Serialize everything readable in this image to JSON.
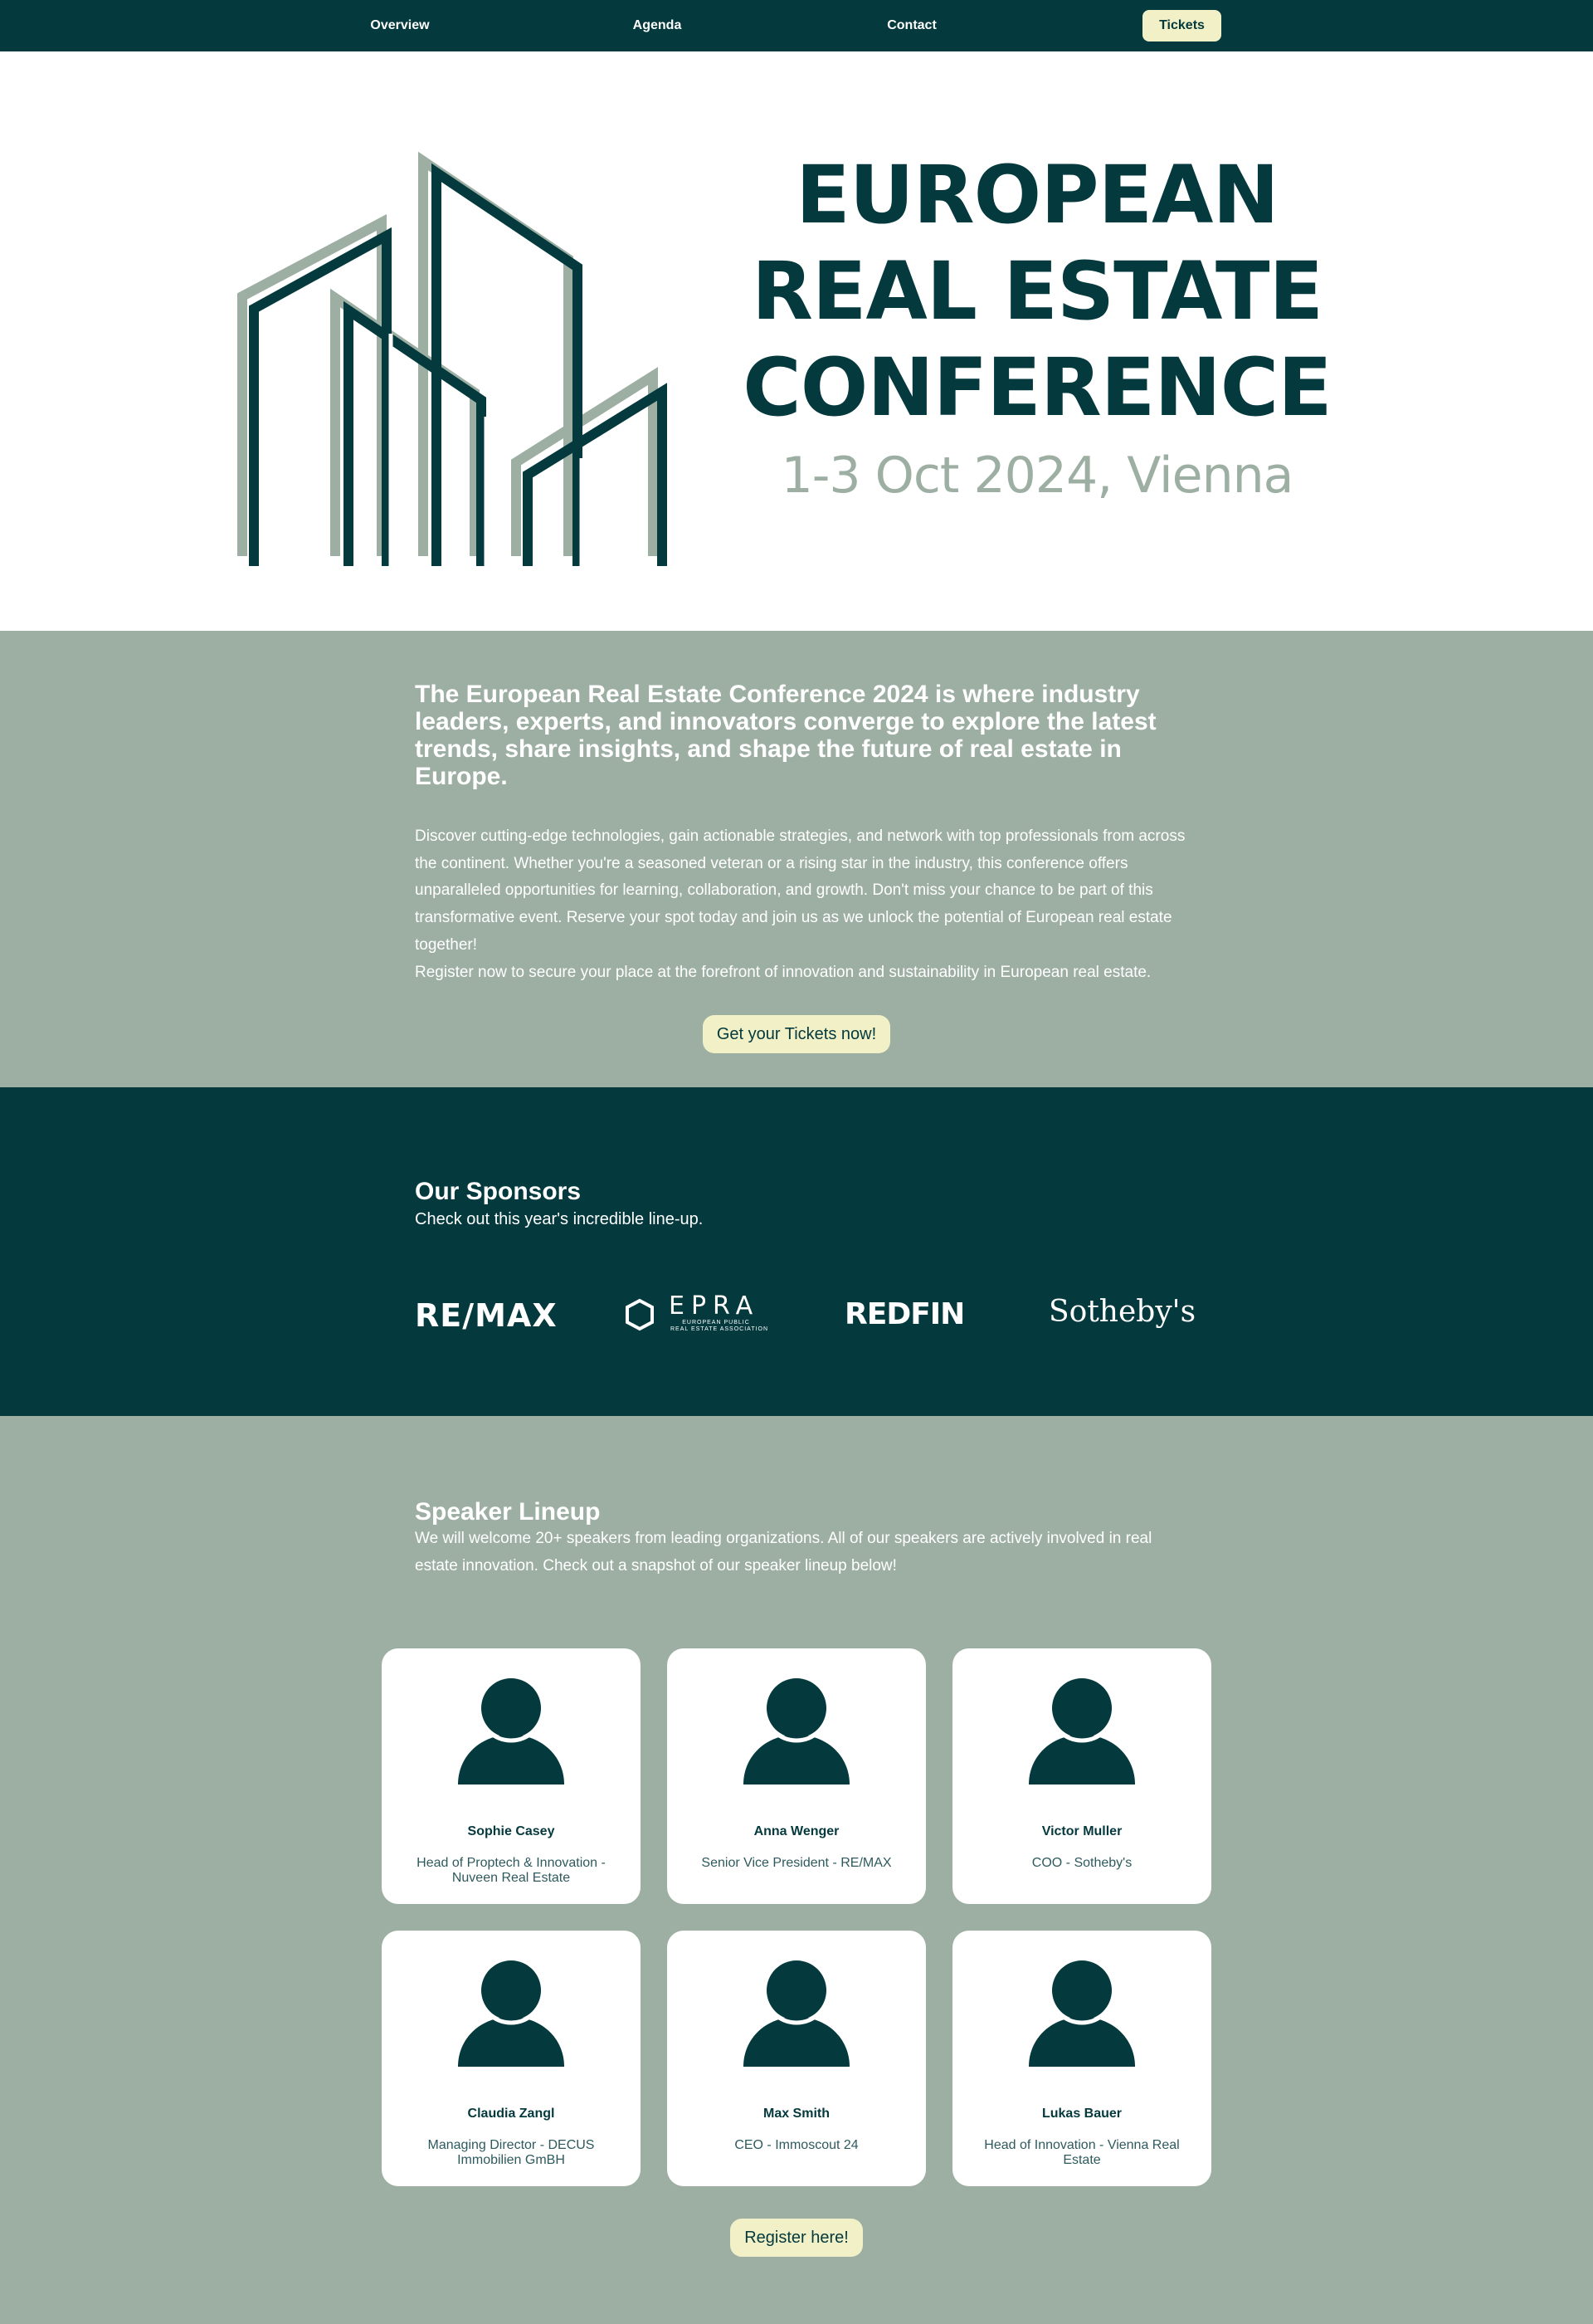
{
  "nav": {
    "overview": "Overview",
    "agenda": "Agenda",
    "contact": "Contact",
    "tickets": "Tickets"
  },
  "hero": {
    "title_line1": "EUROPEAN",
    "title_line2": "REAL ESTATE",
    "title_line3": "CONFERENCE",
    "date": "1-3 Oct 2024, Vienna"
  },
  "intro": {
    "lead": "The European Real Estate Conference 2024 is where industry leaders, experts, and innovators converge to explore the latest trends, share insights, and shape the future of real estate in Europe.",
    "body1": "Discover cutting-edge technologies, gain actionable strategies, and network with top professionals from across the continent. Whether you're a seasoned veteran or a rising star in the industry, this conference offers unparalleled opportunities for learning, collaboration, and growth. Don't miss your chance to be part of this transformative event. Reserve your spot today and join us as we unlock the potential of European real estate together!",
    "body2": "Register now to secure your place at the forefront of innovation and sustainability in European real estate.",
    "cta": "Get your Tickets now!"
  },
  "sponsors": {
    "title": "Our Sponsors",
    "subtitle": "Check out this year's incredible line-up.",
    "logos": {
      "remax": "RE/MAX",
      "epra": "EPRA",
      "epra_sub1": "EUROPEAN PUBLIC",
      "epra_sub2": "REAL ESTATE ASSOCIATION",
      "redfin": "REDFIN",
      "sothebys": "Sotheby's"
    }
  },
  "speakers": {
    "title": "Speaker Lineup",
    "subtitle": "We will welcome 20+ speakers from leading organizations. All of our speakers are actively involved in real estate innovation. Check out a snapshot of our speaker lineup below!",
    "list": [
      {
        "name": "Sophie Casey",
        "role": "Head of Proptech & Innovation - Nuveen Real Estate"
      },
      {
        "name": "Anna Wenger",
        "role": "Senior Vice President - RE/MAX"
      },
      {
        "name": "Victor Muller",
        "role": "COO - Sotheby's"
      },
      {
        "name": "Claudia Zangl",
        "role": "Managing Director - DECUS Immobilien GmBH"
      },
      {
        "name": "Max Smith",
        "role": "CEO - Immoscout 24"
      },
      {
        "name": "Lukas Bauer",
        "role": "Head of Innovation - Vienna Real Estate"
      }
    ],
    "cta": "Register here!"
  },
  "colors": {
    "dark_teal": "#04393d",
    "sage": "#9dafa3",
    "cream": "#f1f0c6",
    "white": "#ffffff"
  },
  "icons": [
    "buildings-logo-icon",
    "person-avatar-icon"
  ]
}
